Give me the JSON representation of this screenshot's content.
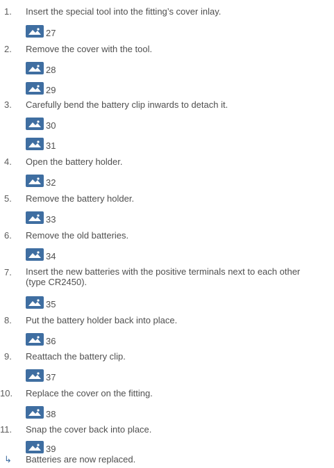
{
  "steps": [
    {
      "num": "1.",
      "text": "Insert the special tool into the fitting’s cover inlay.",
      "figures": [
        "27"
      ]
    },
    {
      "num": "2.",
      "text": "Remove the cover with the tool.",
      "figures": [
        "28",
        "29"
      ]
    },
    {
      "num": "3.",
      "text": "Carefully bend the battery clip inwards to detach it.",
      "figures": [
        "30",
        "31"
      ]
    },
    {
      "num": "4.",
      "text": "Open the battery holder.",
      "figures": [
        "32"
      ]
    },
    {
      "num": "5.",
      "text": "Remove the battery holder.",
      "figures": [
        "33"
      ]
    },
    {
      "num": "6.",
      "text": "Remove the old batteries.",
      "figures": [
        "34"
      ]
    },
    {
      "num": "7.",
      "text": "Insert the new batteries with the positive terminals next to each other (type CR2450).",
      "figures": [
        "35"
      ]
    },
    {
      "num": "8.",
      "text": "Put the battery holder back into place.",
      "figures": [
        "36"
      ]
    },
    {
      "num": "9.",
      "text": "Reattach the battery clip.",
      "figures": [
        "37"
      ]
    },
    {
      "num": "10.",
      "text": "Replace the cover on the fitting.",
      "figures": [
        "38"
      ]
    },
    {
      "num": "11.",
      "text": "Snap the cover back into place.",
      "figures": [
        "39"
      ]
    }
  ],
  "result": {
    "arrow": "↳",
    "text": "Batteries are now replaced."
  },
  "icons": {
    "figure": "image-placeholder-icon"
  },
  "colors": {
    "icon_bg": "#3f6ea1",
    "text": "#4f4f4f"
  }
}
